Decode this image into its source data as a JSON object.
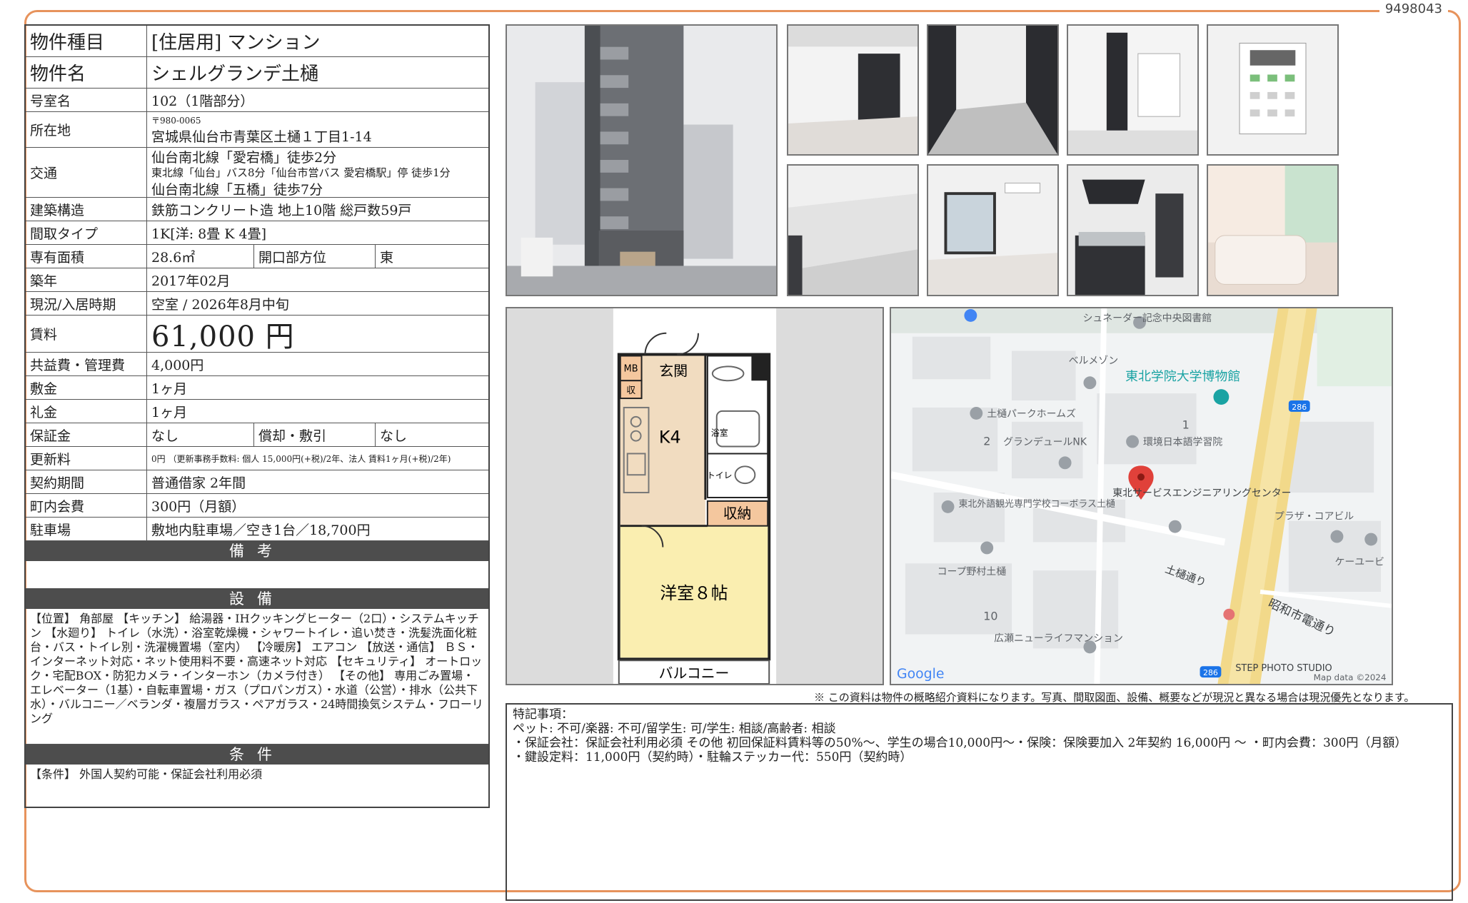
{
  "doc_id": "9498043",
  "rows": {
    "type": {
      "label": "物件種目",
      "value": "[住居用]  マンション"
    },
    "name": {
      "label": "物件名",
      "value": "シェルグランデ土樋"
    },
    "room": {
      "label": "号室名",
      "value": "102（1階部分）"
    },
    "address": {
      "label": "所在地",
      "postal": "〒980-0065",
      "value": "宮城県仙台市青葉区土樋１丁目1-14"
    },
    "access": {
      "label": "交通",
      "lines": [
        "仙台南北線「愛宕橋」徒歩2分",
        "東北線「仙台」バス8分「仙台市営バス 愛宕橋駅」停 徒歩1分",
        "仙台南北線「五橋」徒歩7分"
      ]
    },
    "structure": {
      "label": "建築構造",
      "value": "鉄筋コンクリート造  地上10階  総戸数59戸"
    },
    "layout": {
      "label": "間取タイプ",
      "value": "1K[洋: 8畳  K 4畳]"
    },
    "area": {
      "label": "専有面積",
      "value": "28.6㎡",
      "sub_label": "開口部方位",
      "sub_value": "東"
    },
    "built": {
      "label": "築年",
      "value": "2017年02月"
    },
    "status": {
      "label": "現況/入居時期",
      "value": "空室  /   2026年8月中旬"
    },
    "rent": {
      "label": "賃料",
      "value": "61,000 円"
    },
    "fee": {
      "label": "共益費・管理費",
      "value": "4,000円"
    },
    "deposit": {
      "label": "敷金",
      "value": "1ヶ月"
    },
    "key_money": {
      "label": "礼金",
      "value": "1ヶ月"
    },
    "guarantee": {
      "label": "保証金",
      "value": "なし",
      "sub_label": "償却・敷引",
      "sub_value": "なし"
    },
    "renewal": {
      "label": "更新料",
      "value": "0円  （更新事務手数料: 個人 15,000円(+税)/2年、法人 賃料1ヶ月(+税)/2年)"
    },
    "contract": {
      "label": "契約期間",
      "value": "普通借家  2年間"
    },
    "community": {
      "label": "町内会費",
      "value": "300円（月額）"
    },
    "parking": {
      "label": "駐車場",
      "value": "敷地内駐車場／空き1台／18,700円"
    }
  },
  "bands": {
    "remarks": "備考",
    "equipment": "設備",
    "conditions": "条件"
  },
  "remarks_text": "",
  "equipment_text": "【位置】 角部屋 【キッチン】 給湯器・IHクッキングヒーター（2口）・システムキッチン 【水廻り】 トイレ（水洗）・浴室乾燥機・シャワートイレ・追い焚き・洗髪洗面化粧台・バス・トイレ別・洗濯機置場（室内） 【冷暖房】 エアコン 【放送・通信】 ＢＳ・インターネット対応・ネット使用料不要・高速ネット対応 【セキュリティ】 オートロック・宅配BOX・防犯カメラ・インターホン（カメラ付き） 【その他】 専用ごみ置場・エレベーター（1基）・自転車置場・ガス（プロパンガス）・水道（公営）・排水（公共下水）・バルコニー／ベランダ・複層ガラス・ペアガラス・24時間換気システム・フローリング",
  "conditions_text": "【条件】 外国人契約可能・保証会社利用必須",
  "floorplan": {
    "mb": "MB",
    "storage_small": "収",
    "entrance": "玄関",
    "kitchen": "K4",
    "bath": "浴室",
    "toilet": "トイレ",
    "closet": "収納",
    "western_room": "洋室８帖",
    "balcony": "バルコニー"
  },
  "map": {
    "labels": [
      "シュネーダー記念中央図書館",
      "ベルメゾン",
      "東北学院大学博物館",
      "土樋パークホームズ",
      "グランデュールNK",
      "環境日本語学習院",
      "東北サービスエンジニアリングセンター",
      "東北外語観光専門学校コーボラス土樋",
      "プラザ・コアビル",
      "ケーユービ",
      "コープ野村土樋",
      "土樋通り",
      "昭和市電通り",
      "広瀬ニューライフマンション",
      "Google",
      "STEP PHOTO STUDIO",
      "Map data ©2024",
      "286",
      "286",
      "1",
      "2",
      "10"
    ]
  },
  "disclaimer": "※ この資料は物件の概略紹介資料になります。写真、間取図面、設備、概要などが現況と異なる場合は現況優先となります。",
  "notes": {
    "title": "特記事項：",
    "lines": [
      "ペット: 不可/楽器: 不可/留学生: 可/学生: 相談/高齢者: 相談",
      "・保証会社：保証会社利用必須 その他 初回保証料賃料等の50%〜、学生の場合10,000円〜・保険：保険要加入 2年契約 16,000円 〜 ・町内会費：300円（月額）",
      "・鍵設定料：11,000円（契約時）・駐輪ステッカー代：550円（契約時）"
    ]
  },
  "colors": {
    "frame": "#e7935c",
    "band": "#4d4d4d",
    "map_road": "#f2d98a",
    "pin": "#e0413a",
    "floor_room": "#faeeb0",
    "floor_kitchen": "#f1dcc0"
  }
}
